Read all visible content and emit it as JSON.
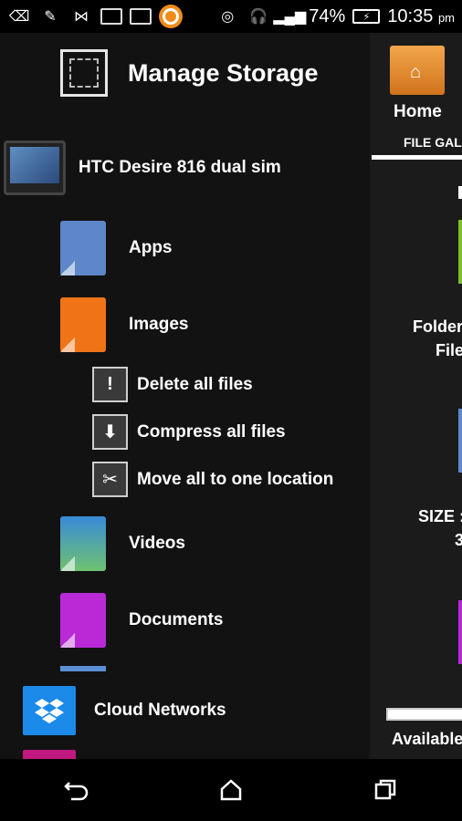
{
  "status_bar": {
    "battery_percent": "74%",
    "time": "10:35",
    "ampm": "pm"
  },
  "drawer": {
    "title": "Manage Storage",
    "device": "HTC Desire 816 dual sim",
    "categories": [
      {
        "label": "Apps",
        "color": "#5d87c8",
        "icon": "apps-swirl-icon"
      },
      {
        "label": "Images",
        "color": "#f07415",
        "icon": "office-icon"
      },
      {
        "label": "Videos",
        "color": "#3a8ad9",
        "icon": "landscape-icon"
      },
      {
        "label": "Documents",
        "color": "#b92ad6",
        "icon": "film-icon"
      }
    ],
    "actions": [
      {
        "label": "Delete all files",
        "icon": "delete-exclamation-icon"
      },
      {
        "label": "Compress all files",
        "icon": "compress-zip-icon"
      },
      {
        "label": "Move all to one location",
        "icon": "scissors-icon"
      }
    ],
    "cloud_label": "Cloud Networks"
  },
  "right_panel": {
    "home_label": "Home",
    "tab_label": "FILE GAL",
    "folder_text": "Folder",
    "file_text": "File",
    "size_text": "SIZE :",
    "size_value": "3",
    "available_text": "Available"
  }
}
